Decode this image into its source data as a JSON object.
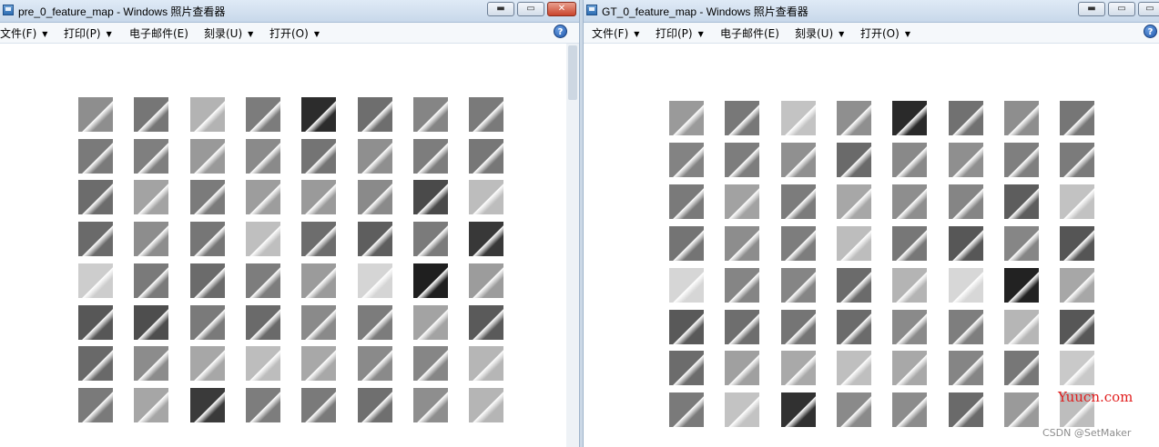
{
  "windows": [
    {
      "title": "pre_0_feature_map - Windows 照片查看器",
      "menu": [
        "文件(F)",
        "打印(P)",
        "电子邮件(E)",
        "刻录(U)",
        "打开(O)"
      ],
      "has_close_highlight": true,
      "tiles": [
        "#8e8e8e",
        "#767676",
        "#b3b3b3",
        "#7c7c7c",
        "#2c2c2c",
        "#6e6e6e",
        "#858585",
        "#7a7a7a",
        "#7a7a7a",
        "#7f7f7f",
        "#999999",
        "#8a8a8a",
        "#747474",
        "#8f8f8f",
        "#7d7d7d",
        "#777777",
        "#6c6c6c",
        "#a3a3a3",
        "#7b7b7b",
        "#9d9d9d",
        "#9a9a9a",
        "#8a8a8a",
        "#4a4a4a",
        "#bdbdbd",
        "#6a6a6a",
        "#8d8d8d",
        "#767676",
        "#bfbfbf",
        "#6d6d6d",
        "#5e5e5e",
        "#7b7b7b",
        "#383838",
        "#cdcdcd",
        "#7a7a7a",
        "#6b6b6b",
        "#7d7d7d",
        "#9b9b9b",
        "#d5d5d5",
        "#1f1f1f",
        "#9c9c9c",
        "#575757",
        "#4e4e4e",
        "#7a7a7a",
        "#6a6a6a",
        "#8a8a8a",
        "#7c7c7c",
        "#a3a3a3",
        "#5a5a5a",
        "#696969",
        "#8c8c8c",
        "#a7a7a7",
        "#bdbdbd",
        "#a8a8a8",
        "#8a8a8a",
        "#868686",
        "#b6b6b6",
        "#7a7a7a",
        "#a6a6a6",
        "#3a3a3a",
        "#7d7d7d",
        "#7a7a7a",
        "#6f6f6f",
        "#8e8e8e",
        "#b5b5b5"
      ]
    },
    {
      "title": "GT_0_feature_map - Windows 照片查看器",
      "menu": [
        "文件(F)",
        "打印(P)",
        "电子邮件(E)",
        "刻录(U)",
        "打开(O)"
      ],
      "has_close_highlight": false,
      "tiles": [
        "#9a9a9a",
        "#787878",
        "#c3c3c3",
        "#8f8f8f",
        "#2a2a2a",
        "#717171",
        "#8e8e8e",
        "#767676",
        "#838383",
        "#7d7d7d",
        "#909090",
        "#6a6a6a",
        "#898989",
        "#8f8f8f",
        "#7f7f7f",
        "#7b7b7b",
        "#7a7a7a",
        "#a2a2a2",
        "#7c7c7c",
        "#a7a7a7",
        "#8e8e8e",
        "#858585",
        "#5d5d5d",
        "#c2c2c2",
        "#747474",
        "#8d8d8d",
        "#7d7d7d",
        "#bdbdbd",
        "#777777",
        "#575757",
        "#868686",
        "#555555",
        "#d6d6d6",
        "#858585",
        "#858585",
        "#6b6b6b",
        "#b4b4b4",
        "#d7d7d7",
        "#222222",
        "#a7a7a7",
        "#595959",
        "#6e6e6e",
        "#757575",
        "#6b6b6b",
        "#8a8a8a",
        "#7e7e7e",
        "#b6b6b6",
        "#575757",
        "#6c6c6c",
        "#a0a0a0",
        "#a9a9a9",
        "#bfbfbf",
        "#a8a8a8",
        "#858585",
        "#777777",
        "#c9c9c9",
        "#7a7a7a",
        "#c3c3c3",
        "#313131",
        "#8a8a8a",
        "#8c8c8c",
        "#6a6a6a",
        "#9a9a9a",
        "#bdbdbd"
      ]
    }
  ],
  "controls": {
    "minimize": "▬",
    "maximize": "▭",
    "close": "✕",
    "help": "?"
  },
  "watermark": {
    "site": "Yuucn.com",
    "csdn": "CSDN @SetMaker"
  }
}
